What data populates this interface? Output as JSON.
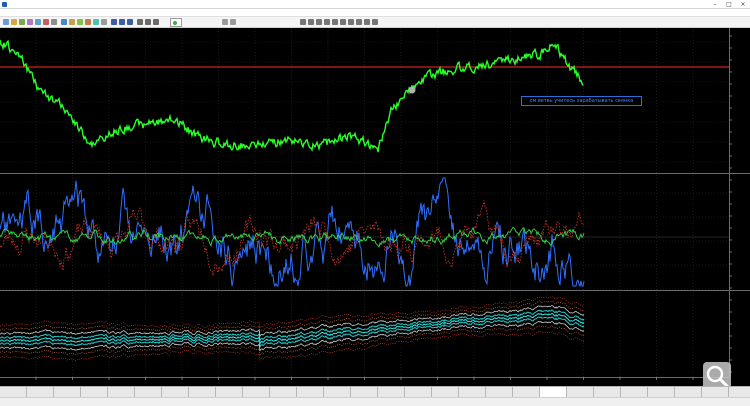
{
  "titlebar": {
    "title": ""
  },
  "menu": {
    "items": [
      "",
      "",
      "",
      "",
      "",
      "",
      "",
      ""
    ]
  },
  "toolbar": {
    "autotrade_label": ""
  },
  "price_chart": {
    "header": [
      "",
      "",
      "",
      "",
      "",
      ""
    ],
    "top_right": "",
    "note": "см ветвь учитесь зарабатывать сеянка",
    "hline_color": "#ff2a2a",
    "line_color": "#2aff2a",
    "marker_color": "#b0b0b0"
  },
  "oscillator": {
    "header": "",
    "legend": [
      "",
      ""
    ]
  },
  "bands": {
    "header": [
      "",
      ""
    ],
    "left_label": ""
  },
  "tabs": {
    "items": [
      "",
      "",
      "",
      "",
      "",
      "",
      "",
      "",
      "",
      "",
      "",
      "",
      "",
      "",
      "",
      "",
      "",
      "",
      "",
      "",
      "",
      "",
      "",
      "",
      "",
      "",
      "",
      ""
    ],
    "active_index": 20
  },
  "status": {
    "left": "",
    "middle": "",
    "right": ""
  }
}
